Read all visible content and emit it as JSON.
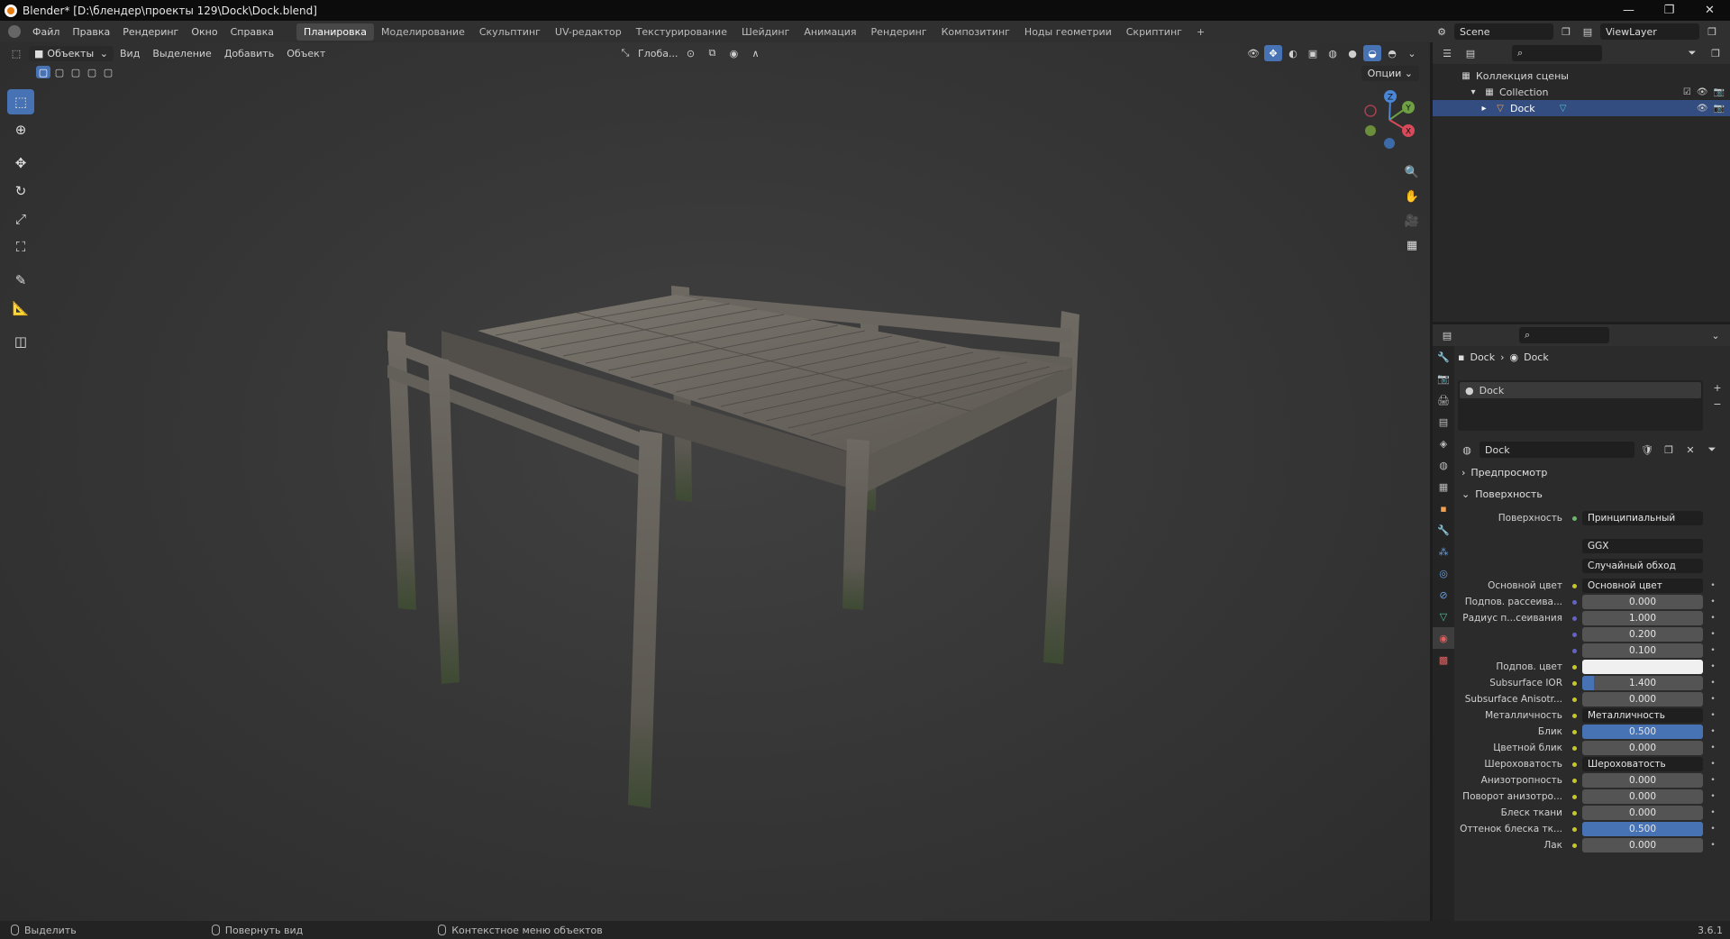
{
  "titlebar": {
    "title": "Blender* [D:\\блендер\\проекты 129\\Dock\\Dock.blend]",
    "minimize": "—",
    "maximize": "❐",
    "close": "✕"
  },
  "menu": {
    "items": [
      "Файл",
      "Правка",
      "Рендеринг",
      "Окно",
      "Справка"
    ]
  },
  "workspaces": [
    "Планировка",
    "Моделирование",
    "Скульптинг",
    "UV-редактор",
    "Текстурирование",
    "Шейдинг",
    "Анимация",
    "Рендеринг",
    "Композитинг",
    "Ноды геометрии",
    "Скриптинг"
  ],
  "workspace_add": "+",
  "scene": {
    "name": "Scene",
    "view_layer": "ViewLayer"
  },
  "viewport": {
    "mode": "Объекты",
    "menus": [
      "Вид",
      "Выделение",
      "Добавить",
      "Объект"
    ],
    "transform_orientation": "Глоба...",
    "options": "Опции"
  },
  "gizmo": {
    "x": "X",
    "y": "Y",
    "z": "Z"
  },
  "outliner": {
    "root": "Коллекция сцены",
    "collection": "Collection",
    "object": "Dock"
  },
  "properties": {
    "breadcrumb": [
      "Dock",
      "Dock"
    ],
    "slot_name": "Dock",
    "material_name": "Dock",
    "sections": {
      "preview": "Предпросмотр",
      "surface": "Поверхность"
    },
    "surface_label": "Поверхность",
    "surface_value": "Принципиальный BSDF",
    "distribution": "GGX",
    "subsurface_method": "Случайный обход",
    "rows": [
      {
        "label": "Основной цвет",
        "value": "Основной цвет",
        "link": true
      },
      {
        "label": "Подпов. рассеива...",
        "value": "0.000"
      },
      {
        "label": "Радиус п...сеивания",
        "value": "1.000"
      },
      {
        "label": "",
        "value": "0.200"
      },
      {
        "label": "",
        "value": "0.100"
      },
      {
        "label": "Подпов. цвет",
        "value": ""
      },
      {
        "label": "Subsurface IOR",
        "value": "1.400",
        "fill": 0.1
      },
      {
        "label": "Subsurface Anisotr...",
        "value": "0.000"
      },
      {
        "label": "Металличность",
        "value": "Металличность",
        "link": true
      },
      {
        "label": "Блик",
        "value": "0.500",
        "fill": 1.0
      },
      {
        "label": "Цветной блик",
        "value": "0.000"
      },
      {
        "label": "Шероховатость",
        "value": "Шероховатость",
        "link": true
      },
      {
        "label": "Анизотропность",
        "value": "0.000"
      },
      {
        "label": "Поворот анизотро...",
        "value": "0.000"
      },
      {
        "label": "Блеск ткани",
        "value": "0.000"
      },
      {
        "label": "Оттенок блеска тк...",
        "value": "0.500",
        "fill": 1.0
      },
      {
        "label": "Лак",
        "value": "0.000"
      }
    ]
  },
  "status": {
    "select": "Выделить",
    "rotate": "Повернуть вид",
    "context": "Контекстное меню объектов",
    "version": "3.6.1"
  },
  "colors": {
    "accent": "#4772b3",
    "selected_row": "#334d80",
    "header": "#303030"
  }
}
